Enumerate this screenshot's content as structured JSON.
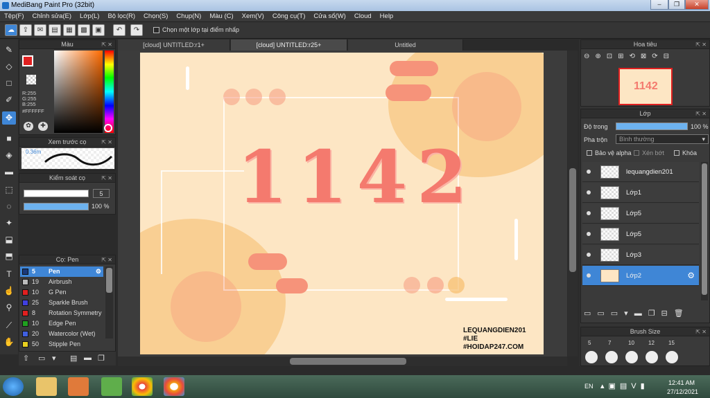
{
  "window": {
    "title": "MediBang Paint Pro (32bit)"
  },
  "menu": [
    "Tệp(F)",
    "Chỉnh sửa(E)",
    "Lớp(L)",
    "Bộ lọc(R)",
    "Chọn(S)",
    "Chụp(N)",
    "Màu (C)",
    "Xem(V)",
    "Công cụ(T)",
    "Cửa sổ(W)",
    "Cloud",
    "Help"
  ],
  "toolbar": {
    "select_layer_label": "Chọn một lớp tại điểm nhấp"
  },
  "color_panel": {
    "title": "Màu",
    "r": "R:255",
    "g": "G:255",
    "b": "B:255",
    "hex": "#FFFFFF"
  },
  "preview_panel": {
    "title": "Xem trước cọ",
    "size": "0.36m"
  },
  "control_panel": {
    "title": "Kiểm soát cọ",
    "size_value": "5",
    "opacity_value": "100 %",
    "opacity_level": 1.0
  },
  "brush_panel": {
    "title": "Cọ: Pen",
    "items": [
      {
        "num": "5",
        "name": "Pen",
        "color": "#1a3a7a",
        "selected": true
      },
      {
        "num": "19",
        "name": "Airbrush",
        "color": "#bbbbbb"
      },
      {
        "num": "10",
        "name": "G Pen",
        "color": "#e02020"
      },
      {
        "num": "25",
        "name": "Sparkle Brush",
        "color": "#4040e0"
      },
      {
        "num": "8",
        "name": "Rotation Symmetry",
        "color": "#e02020"
      },
      {
        "num": "10",
        "name": "Edge Pen",
        "color": "#20a020"
      },
      {
        "num": "20",
        "name": "Watercolor (Wet)",
        "color": "#4060e0"
      },
      {
        "num": "50",
        "name": "Stipple Pen",
        "color": "#e8d020"
      }
    ]
  },
  "tabs": [
    {
      "label": "[cloud] UNTITLED:r1+"
    },
    {
      "label": "[cloud] UNTITLED:r25+"
    },
    {
      "label": "Untitled"
    }
  ],
  "artwork": {
    "title": "1142",
    "watermark_line1": "LEQUANGDIEN201",
    "watermark_line2": "#LIE",
    "watermark_line3": "#HOIDAP247.COM"
  },
  "navigator": {
    "title": "Hoa tiêu"
  },
  "layer_panel": {
    "title": "Lớp",
    "opacity_label": "Độ trong",
    "opacity_value": "100 %",
    "blend_label": "Pha trộn",
    "blend_value": "Bình thường",
    "protect_alpha": "Bảo vệ alpha",
    "clipping": "Xén bớt",
    "lock": "Khóa",
    "layers": [
      {
        "name": "lequangdien201"
      },
      {
        "name": "Lớp1"
      },
      {
        "name": "Lớp5"
      },
      {
        "name": "Lớp5"
      },
      {
        "name": "Lớp3"
      },
      {
        "name": "Lớp2",
        "selected": true
      }
    ]
  },
  "brush_size": {
    "title": "Brush Size",
    "sizes": [
      "5",
      "7",
      "10",
      "12",
      "15"
    ]
  },
  "taskbar": {
    "lang": "EN",
    "time": "12:41 AM",
    "date": "27/12/2021"
  },
  "colors": {
    "accent": "#3f86d6",
    "art_bg": "#fde6c4",
    "art_text": "#f47a6e"
  }
}
